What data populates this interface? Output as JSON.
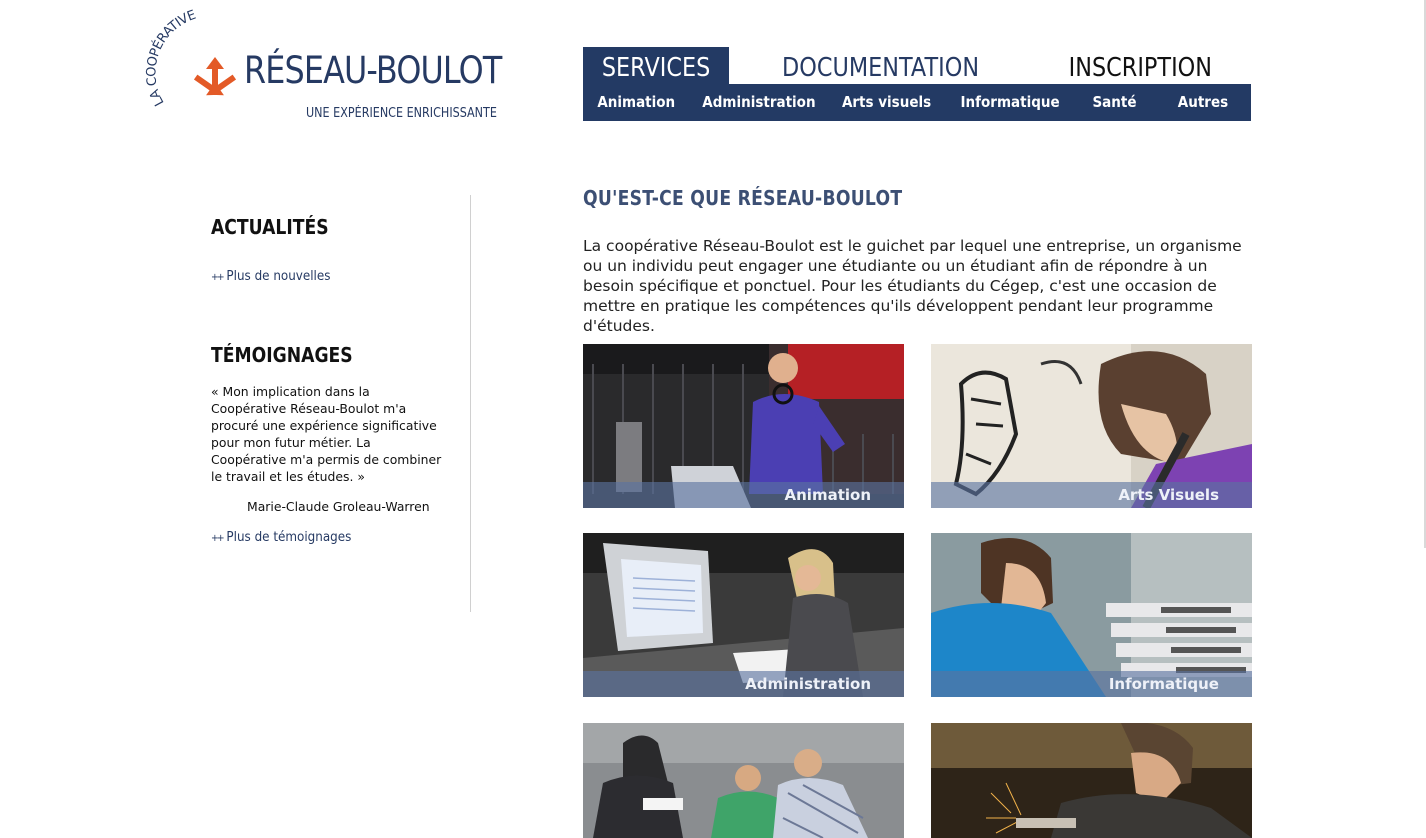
{
  "logo": {
    "arc_text": "LA COOPÉRATIVE",
    "name": "RÉSEAU-BOULOT",
    "tagline": "UNE EXPÉRIENCE ENRICHISSANTE",
    "colors": {
      "brand_blue": "#263a63",
      "brand_orange": "#e35a27"
    }
  },
  "nav": {
    "tabs": [
      {
        "label": "SERVICES",
        "active": true
      },
      {
        "label": "DOCUMENTATION",
        "active": false
      },
      {
        "label": "INSCRIPTION",
        "active": false
      }
    ],
    "subnav": [
      "Animation",
      "Administration",
      "Arts visuels",
      "Informatique",
      "Santé",
      "Autres"
    ]
  },
  "sidebar": {
    "news": {
      "heading": "ACTUALITÉS",
      "more_link": "Plus de nouvelles"
    },
    "testimonials": {
      "heading": "TÉMOIGNAGES",
      "quote": "« Mon implication dans la Coopérative Réseau-Boulot m'a procuré une expérience significative pour mon futur métier. La Coopérative m'a permis de combiner le travail et les études. »",
      "author": "Marie-Claude Groleau-Warren",
      "more_link": "Plus de témoignages"
    },
    "link_prefix": "++"
  },
  "main": {
    "title": "QU'EST-CE QUE RÉSEAU-BOULOT",
    "intro": "La coopérative Réseau-Boulot est le guichet par lequel une entreprise, un organisme ou un individu peut engager une étudiante ou un étudiant afin de répondre à un besoin spécifique et ponctuel. Pour les étudiants du Cégep, c'est une occasion de mettre en pratique les compétences qu'ils développent pendant leur programme d'études.",
    "tiles": [
      {
        "label": "Animation"
      },
      {
        "label": "Arts Visuels"
      },
      {
        "label": "Administration"
      },
      {
        "label": "Informatique"
      },
      {
        "label": ""
      },
      {
        "label": ""
      }
    ]
  },
  "colors": {
    "nav_bg": "#233a64",
    "title": "#3c4f74",
    "tile_label_bg": "rgba(90,115,160,0.62)"
  }
}
